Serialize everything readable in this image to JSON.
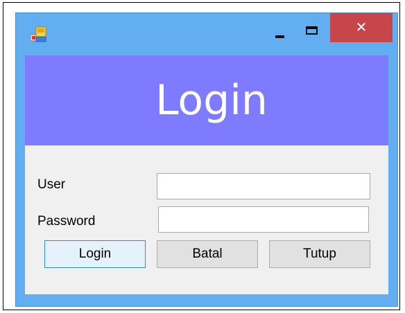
{
  "window": {
    "title": "",
    "icon": "app-window-icon",
    "close_glyph": "✕"
  },
  "header": {
    "title": "Login",
    "color": "#7f7bff"
  },
  "form": {
    "user_label": "User",
    "user_value": "",
    "password_label": "Password",
    "password_value": ""
  },
  "buttons": {
    "login_label": "Login",
    "cancel_label": "Batal",
    "close_label": "Tutup"
  },
  "colors": {
    "titlebar": "#62aef0",
    "close_button": "#c7464b",
    "client_background": "#f0f0f0"
  }
}
